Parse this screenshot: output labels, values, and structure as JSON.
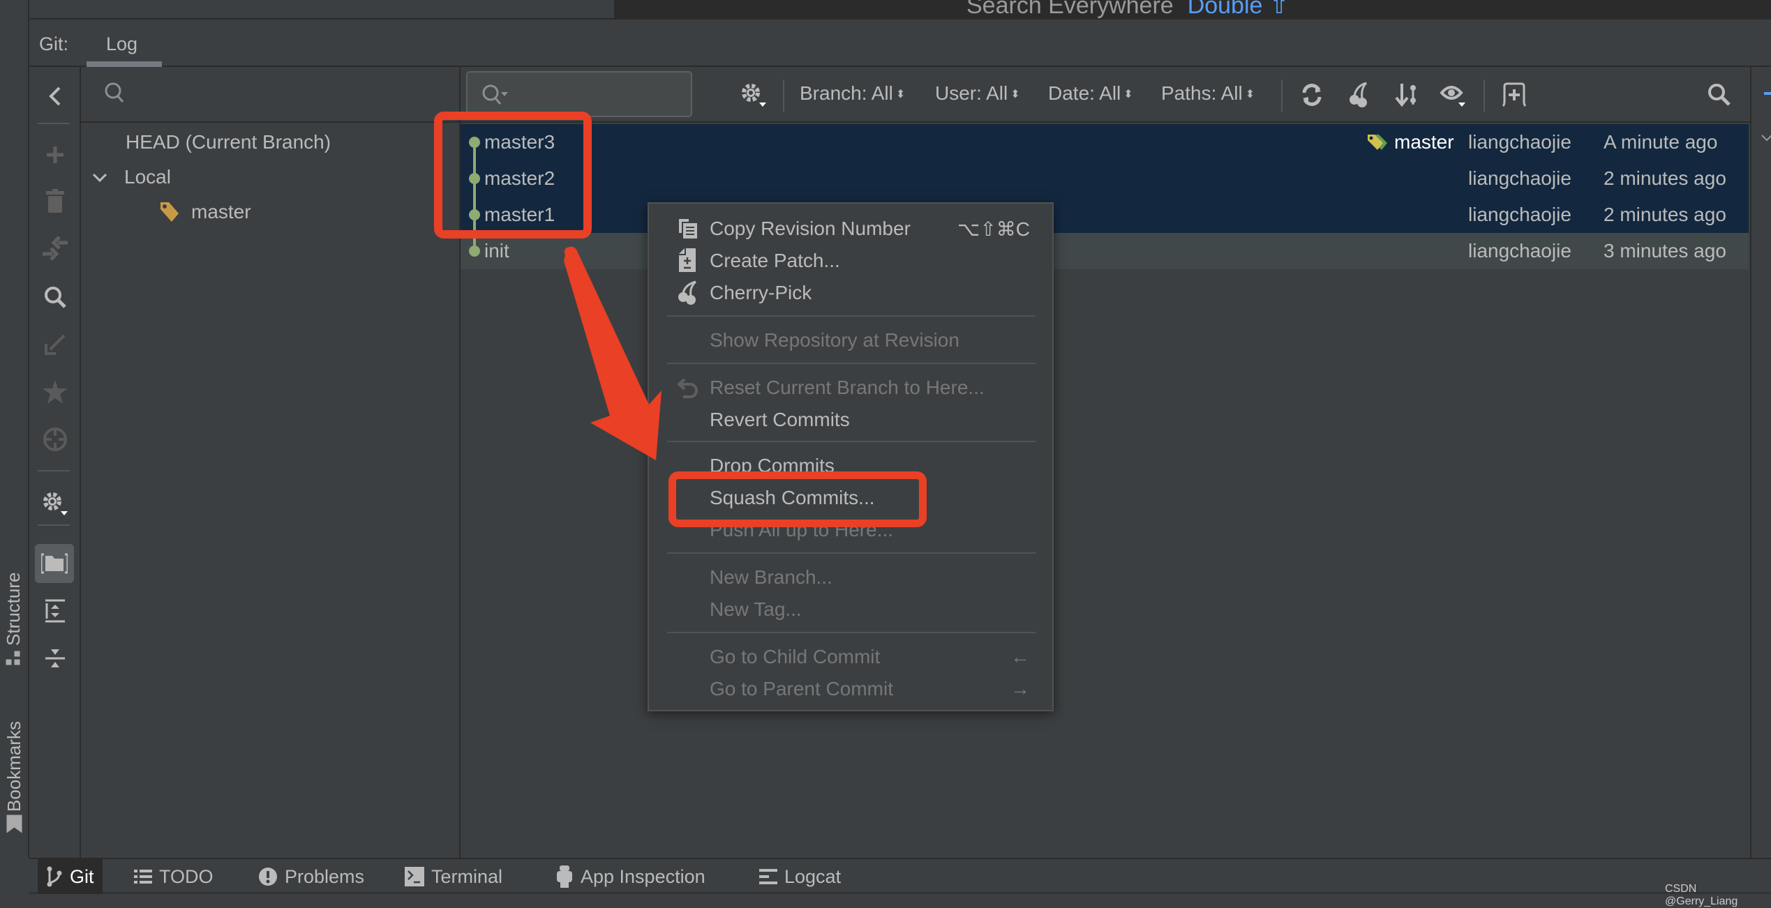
{
  "header": {
    "search_everywhere_label": "Search Everywhere",
    "search_everywhere_hint": "Double ⇧"
  },
  "tool_window": {
    "prefix": "Git:",
    "tabs": [
      {
        "label": "Log",
        "active": true
      }
    ]
  },
  "branches_panel": {
    "search_placeholder": "",
    "tree": [
      {
        "label": "HEAD (Current Branch)",
        "level": 0
      },
      {
        "label": "Local",
        "level": 0,
        "expanded": true
      },
      {
        "label": "master",
        "level": 1,
        "icon": "tag-icon"
      }
    ]
  },
  "log_toolbar": {
    "filter_placeholder": "",
    "filters": [
      {
        "label": "Branch: All"
      },
      {
        "label": "User: All"
      },
      {
        "label": "Date: All"
      },
      {
        "label": "Paths: All"
      }
    ]
  },
  "commits": [
    {
      "message": "master3",
      "ref": "master",
      "author": "liangchaojie",
      "date": "A minute ago",
      "selected": true
    },
    {
      "message": "master2",
      "ref": "",
      "author": "liangchaojie",
      "date": "2 minutes ago",
      "selected": true
    },
    {
      "message": "master1",
      "ref": "",
      "author": "liangchaojie",
      "date": "2 minutes ago",
      "selected": true
    },
    {
      "message": "init",
      "ref": "",
      "author": "liangchaojie",
      "date": "3 minutes ago",
      "selected": false
    }
  ],
  "context_menu": {
    "items": [
      {
        "label": "Copy Revision Number",
        "shortcut": "⌥⇧⌘C",
        "enabled": true,
        "icon": "copy-icon"
      },
      {
        "label": "Create Patch...",
        "shortcut": "",
        "enabled": true,
        "icon": "patch-icon"
      },
      {
        "label": "Cherry-Pick",
        "shortcut": "",
        "enabled": true,
        "icon": "cherry-icon"
      },
      {
        "label": "Show Repository at Revision",
        "shortcut": "",
        "enabled": false
      },
      {
        "label": "Reset Current Branch to Here...",
        "shortcut": "",
        "enabled": false,
        "icon": "undo-icon"
      },
      {
        "label": "Revert Commits",
        "shortcut": "",
        "enabled": true
      },
      {
        "label": "Drop Commits",
        "shortcut": "",
        "enabled": true
      },
      {
        "label": "Squash Commits...",
        "shortcut": "",
        "enabled": true,
        "highlighted_annotation": true
      },
      {
        "label": "Push All up to Here...",
        "shortcut": "",
        "enabled": false
      },
      {
        "label": "New Branch...",
        "shortcut": "",
        "enabled": false
      },
      {
        "label": "New Tag...",
        "shortcut": "",
        "enabled": false
      },
      {
        "label": "Go to Child Commit",
        "shortcut": "←",
        "enabled": false
      },
      {
        "label": "Go to Parent Commit",
        "shortcut": "→",
        "enabled": false
      }
    ]
  },
  "side_labels": {
    "structure": "Structure",
    "bookmarks": "Bookmarks"
  },
  "bottom_tabs": [
    {
      "label": "Git",
      "icon": "git-branch-icon",
      "active": true
    },
    {
      "label": "TODO",
      "icon": "list-icon",
      "active": false
    },
    {
      "label": "Problems",
      "icon": "problems-icon",
      "active": false
    },
    {
      "label": "Terminal",
      "icon": "terminal-icon",
      "active": false
    },
    {
      "label": "App Inspection",
      "icon": "inspection-icon",
      "active": false
    },
    {
      "label": "Logcat",
      "icon": "logcat-icon",
      "active": false
    }
  ],
  "watermark": "CSDN @Gerry_Liang",
  "colors": {
    "selection": "#13283f",
    "graph": "#8faa72",
    "annotation": "#e94026",
    "link": "#589df6"
  }
}
